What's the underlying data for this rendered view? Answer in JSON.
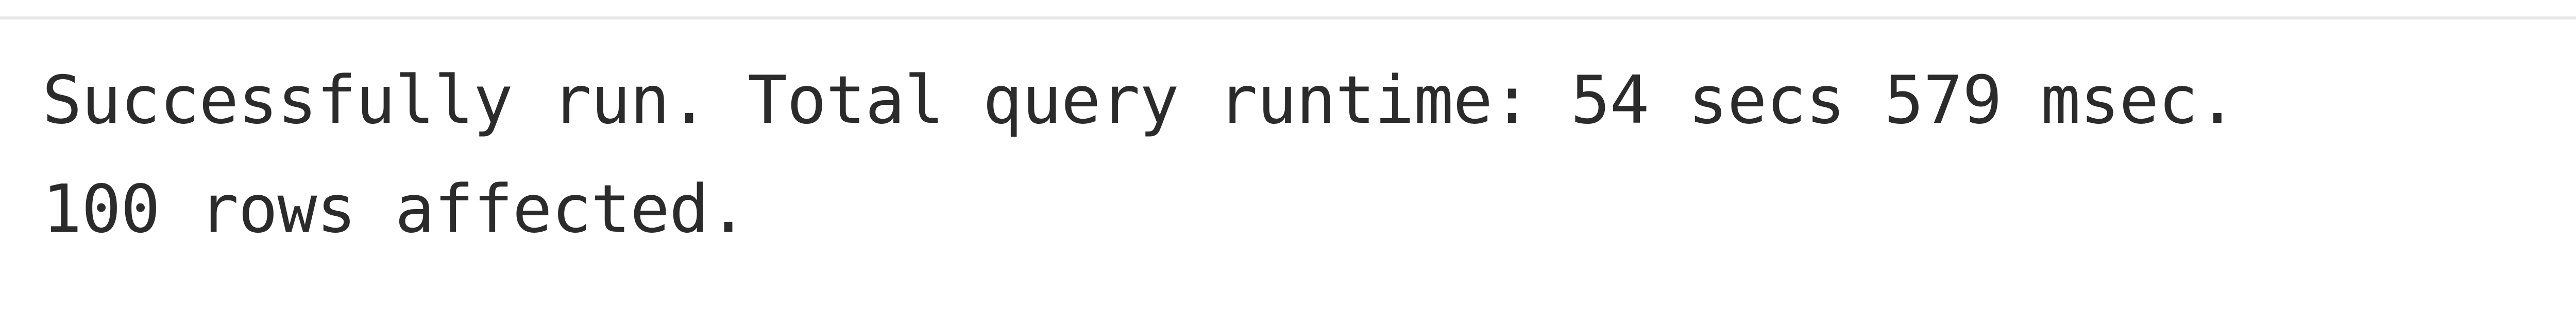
{
  "query_output": {
    "status_line": "Successfully run. Total query runtime: 54 secs 579 msec.",
    "rows_line": "100 rows affected."
  }
}
